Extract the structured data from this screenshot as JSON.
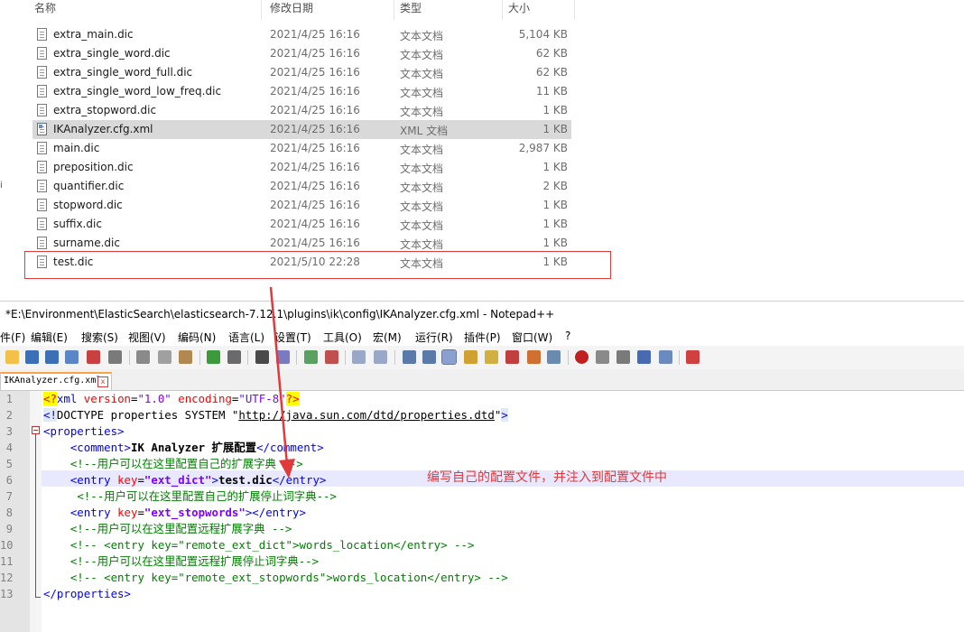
{
  "explorer": {
    "columns": {
      "name": "名称",
      "date": "修改日期",
      "type": "类型",
      "size": "大小"
    },
    "files": [
      {
        "name": "extra_main.dic",
        "date": "2021/4/25 16:16",
        "type": "文本文档",
        "size": "5,104 KB"
      },
      {
        "name": "extra_single_word.dic",
        "date": "2021/4/25 16:16",
        "type": "文本文档",
        "size": "62 KB"
      },
      {
        "name": "extra_single_word_full.dic",
        "date": "2021/4/25 16:16",
        "type": "文本文档",
        "size": "62 KB"
      },
      {
        "name": "extra_single_word_low_freq.dic",
        "date": "2021/4/25 16:16",
        "type": "文本文档",
        "size": "11 KB"
      },
      {
        "name": "extra_stopword.dic",
        "date": "2021/4/25 16:16",
        "type": "文本文档",
        "size": "1 KB"
      },
      {
        "name": "IKAnalyzer.cfg.xml",
        "date": "2021/4/25 16:16",
        "type": "XML 文档",
        "size": "1 KB",
        "selected": true
      },
      {
        "name": "main.dic",
        "date": "2021/4/25 16:16",
        "type": "文本文档",
        "size": "2,987 KB"
      },
      {
        "name": "preposition.dic",
        "date": "2021/4/25 16:16",
        "type": "文本文档",
        "size": "1 KB"
      },
      {
        "name": "quantifier.dic",
        "date": "2021/4/25 16:16",
        "type": "文本文档",
        "size": "2 KB"
      },
      {
        "name": "stopword.dic",
        "date": "2021/4/25 16:16",
        "type": "文本文档",
        "size": "1 KB"
      },
      {
        "name": "suffix.dic",
        "date": "2021/4/25 16:16",
        "type": "文本文档",
        "size": "1 KB"
      },
      {
        "name": "surname.dic",
        "date": "2021/4/25 16:16",
        "type": "文本文档",
        "size": "1 KB"
      },
      {
        "name": "test.dic",
        "date": "2021/5/10 22:28",
        "type": "文本文档",
        "size": "1 KB"
      }
    ],
    "left_mark": "i"
  },
  "notepad": {
    "title": "*E:\\Environment\\ElasticSearch\\elasticsearch-7.12.1\\plugins\\ik\\config\\IKAnalyzer.cfg.xml - Notepad++",
    "menu": [
      "件(F)",
      "编辑(E)",
      "搜索(S)",
      "视图(V)",
      "编码(N)",
      "语言(L)",
      "设置(T)",
      "工具(O)",
      "宏(M)",
      "运行(R)",
      "插件(P)",
      "窗口(W)",
      "?"
    ],
    "tab_label": "IKAnalyzer.cfg.xml",
    "tab_close": "x",
    "line_numbers": [
      "1",
      "2",
      "3",
      "4",
      "5",
      "6",
      "7",
      "8",
      "9",
      "10",
      "11",
      "12",
      "13"
    ],
    "code": {
      "l1": {
        "open": "<?",
        "name": "xml",
        "a1": " version",
        "eq1": "=",
        "v1": "\"1.0\"",
        "a2": " encoding",
        "eq2": "=",
        "v2": "\"UTF-8\"",
        "close": "?>"
      },
      "l2": {
        "open": "<!",
        "body": "DOCTYPE properties SYSTEM \"",
        "url": "http://java.sun.com/dtd/properties.dtd",
        "end": "\"",
        "close": ">"
      },
      "l3": {
        "tag": "<properties>"
      },
      "l4": {
        "indent": "    ",
        "open": "<comment>",
        "text": "IK Analyzer 扩展配置",
        "close": "</comment>"
      },
      "l5": {
        "indent": "    ",
        "comment": "<!--用户可以在这里配置自己的扩展字典 -->"
      },
      "l6": {
        "indent": "    ",
        "open": "<entry",
        "attr": " key",
        "eq": "=",
        "val": "\"ext_dict\"",
        "gt": ">",
        "text": "test.dic",
        "close": "</entry>"
      },
      "l7": {
        "indent": "     ",
        "comment": "<!--用户可以在这里配置自己的扩展停止词字典-->"
      },
      "l8": {
        "indent": "    ",
        "open": "<entry",
        "attr": " key",
        "eq": "=",
        "val": "\"ext_stopwords\"",
        "close": "></entry>"
      },
      "l9": {
        "indent": "    ",
        "comment": "<!--用户可以在这里配置远程扩展字典 -->"
      },
      "l10": {
        "indent": "    ",
        "comment": "<!-- <entry key=\"remote_ext_dict\">words_location</entry> -->"
      },
      "l11": {
        "indent": "    ",
        "comment": "<!--用户可以在这里配置远程扩展停止词字典-->"
      },
      "l12": {
        "indent": "    ",
        "comment": "<!-- <entry key=\"remote_ext_stopwords\">words_location</entry> -->"
      },
      "l13": {
        "tag": "</properties>"
      }
    }
  },
  "annotation": "编写自己的配置文件，并注入到配置文件中",
  "colors": {
    "annotation_red": "#e03a3a",
    "selection_gray": "#d9d9d9",
    "current_line": "#e8e8ff"
  }
}
